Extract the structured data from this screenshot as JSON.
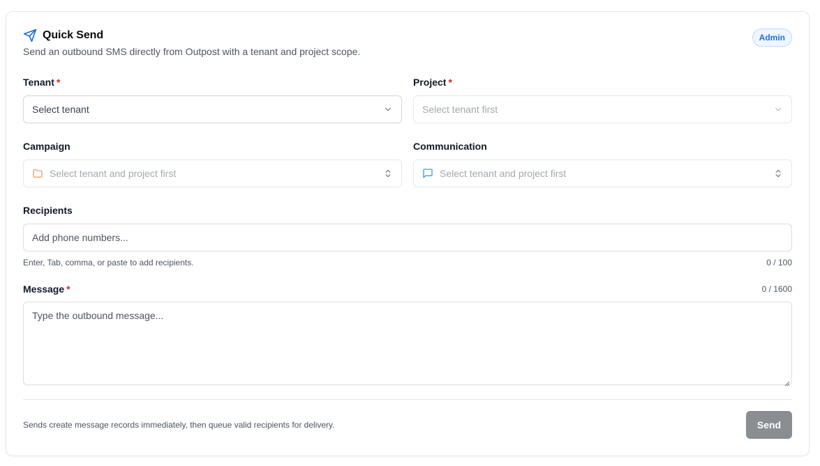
{
  "header": {
    "title": "Quick Send",
    "subtitle": "Send an outbound SMS directly from Outpost with a tenant and project scope.",
    "badge": "Admin",
    "icon": "send-icon"
  },
  "fields": {
    "tenant": {
      "label": "Tenant",
      "required_mark": "*",
      "value": "Select tenant"
    },
    "project": {
      "label": "Project",
      "required_mark": "*",
      "placeholder": "Select tenant first"
    },
    "campaign": {
      "label": "Campaign",
      "placeholder": "Select tenant and project first",
      "icon": "folder-icon"
    },
    "communication": {
      "label": "Communication",
      "placeholder": "Select tenant and project first",
      "icon": "message-square-icon"
    },
    "recipients": {
      "label": "Recipients",
      "placeholder": "Add phone numbers...",
      "help": "Enter, Tab, comma, or paste to add recipients.",
      "counter": "0 / 100"
    },
    "message": {
      "label": "Message",
      "required_mark": "*",
      "placeholder": "Type the outbound message...",
      "counter": "0 / 1600"
    }
  },
  "footer": {
    "note": "Sends create message records immediately, then queue valid recipients for delivery.",
    "send_label": "Send"
  },
  "colors": {
    "accent": "#1d6fd6",
    "required": "#dc2626",
    "folder": "#f59e6b",
    "message_icon": "#3b9cf0",
    "send_disabled": "#8a8d92"
  }
}
